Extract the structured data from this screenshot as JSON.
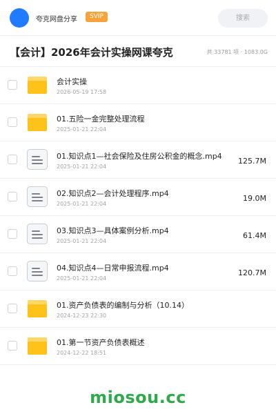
{
  "header": {
    "username": "夸克网盘分享",
    "badge": "SVIP",
    "search_placeholder": "搜索"
  },
  "page": {
    "title": "【会计】2026年会计实操网课夸克",
    "meta": "共 33781 项 · 1083.0G"
  },
  "files": [
    {
      "type": "folder",
      "name": "会计实操",
      "date": "2026-05-19 17:58",
      "size": ""
    },
    {
      "type": "folder",
      "name": "01.五险一金完整处理流程",
      "date": "2025-01-21 22:04",
      "size": ""
    },
    {
      "type": "video",
      "name": "01.知识点1—社会保险及住房公积金的概念.mp4",
      "date": "2025-01-21 22:04",
      "size": "125.7M"
    },
    {
      "type": "video",
      "name": "02.知识点2—会计处理程序.mp4",
      "date": "2025-01-21 22:04",
      "size": "19.0M"
    },
    {
      "type": "video",
      "name": "03.知识点3—具体案例分析.mp4",
      "date": "2025-01-21 22:04",
      "size": "61.4M"
    },
    {
      "type": "video",
      "name": "04.知识点4—日常申报流程.mp4",
      "date": "2025-01-21 22:04",
      "size": "120.7M"
    },
    {
      "type": "folder",
      "name": "01.资产负债表的编制与分析（10.14）",
      "date": "2024-12-23 22:30",
      "size": ""
    },
    {
      "type": "folder",
      "name": "01.第一节资产负债表概述",
      "date": "2024-12-22 18:51",
      "size": ""
    }
  ],
  "footer": {
    "watermark": "miosou.cc"
  },
  "colors": {
    "accent": "#1f7bff",
    "svip": "#f7a23a",
    "folder": "#ffc21a",
    "watermark": "#2eaa4a"
  },
  "icons": {
    "folder": "folder-icon",
    "video": "document-icon"
  }
}
